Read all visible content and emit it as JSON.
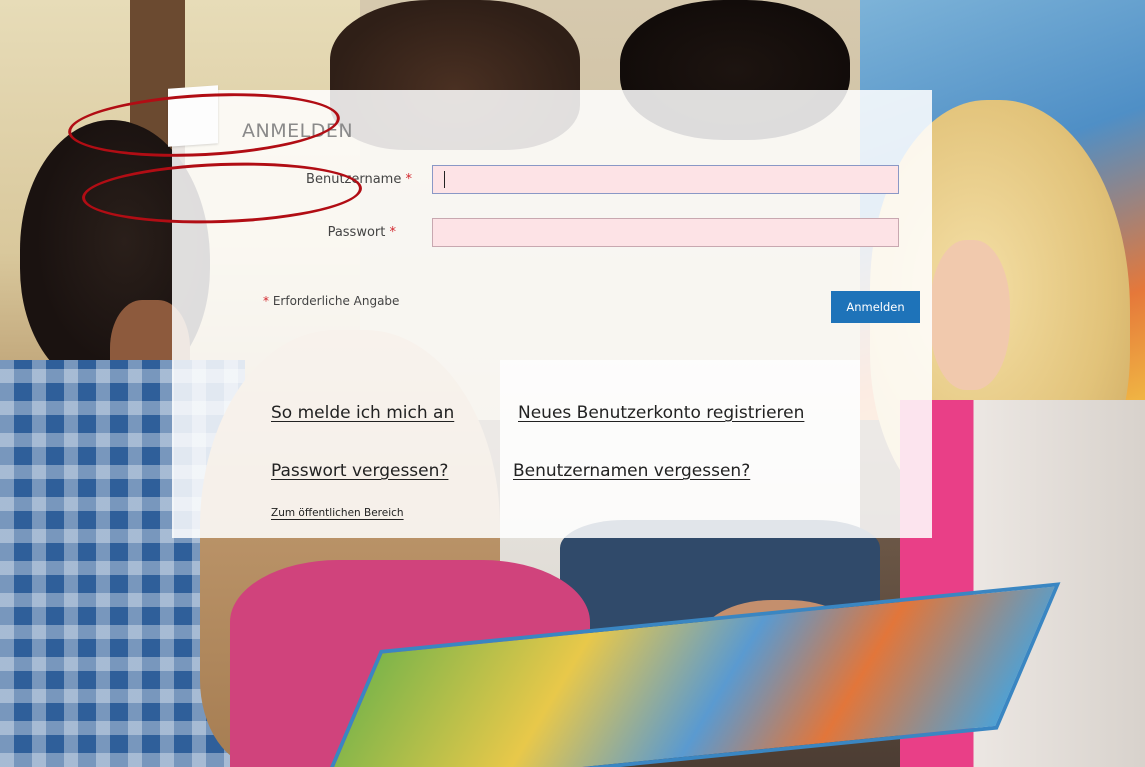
{
  "login": {
    "title": "ANMELDEN",
    "username_label": "Benutzername",
    "password_label": "Passwort",
    "required_marker": "*",
    "username_value": "",
    "password_value": "",
    "required_note": "Erforderliche Angabe",
    "submit_label": "Anmelden"
  },
  "links": {
    "how_to_login": "So melde ich mich an",
    "register": "Neues Benutzerkonto registrieren",
    "forgot_password": "Passwort vergessen?",
    "forgot_username": "Benutzernamen vergessen?",
    "public_area": "Zum öffentlichen Bereich"
  },
  "colors": {
    "primary_button": "#1e73b9",
    "required": "#d2262d",
    "input_invalid_bg": "#fde3e6",
    "annotation": "#b10d14"
  }
}
